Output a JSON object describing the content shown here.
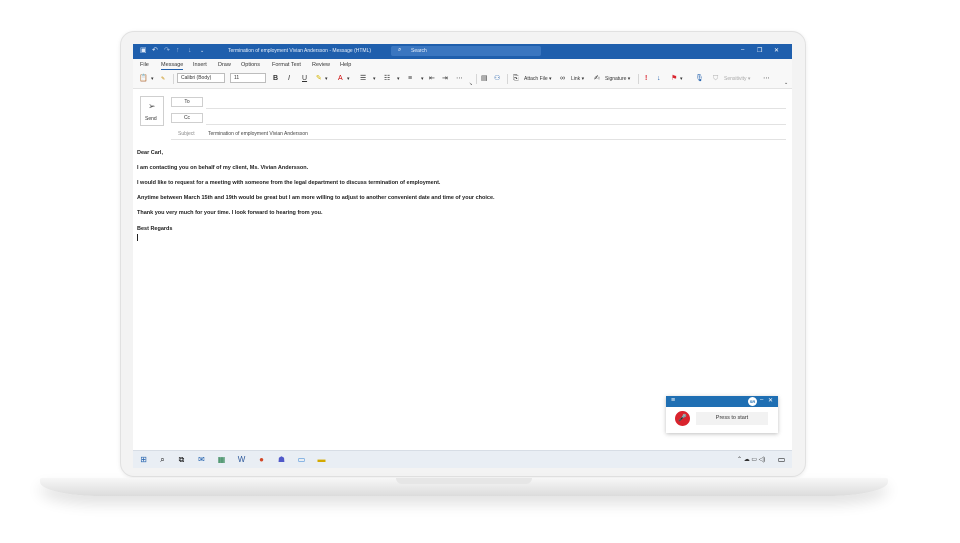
{
  "window": {
    "title": "Termination of employment Vivian Andersson  -  Message (HTML)",
    "search_placeholder": "Search"
  },
  "menu": [
    "File",
    "Message",
    "Insert",
    "Draw",
    "Options",
    "Format Text",
    "Review",
    "Help"
  ],
  "ribbon": {
    "font": "Calibri (Body)",
    "size": "11",
    "attach_file": "Attach File",
    "link": "Link",
    "signature": "Signature",
    "sensitivity": "Sensitivity"
  },
  "compose": {
    "send_label": "Send",
    "to_label": "To",
    "cc_label": "Cc",
    "subject_label": "Subject",
    "subject_value": "Termination of employment Vivian Andersson"
  },
  "body": [
    "Dear Carl,",
    "I am contacting you on behalf of my client, Ms. Vivian Andersson.",
    "I would like to request for a meeting with someone from the legal department to discuss termination of employment.",
    "Anytime between March 15th and 19th would be great but I am more willing to adjust to another convenient date and time of your choice.",
    "Thank you very much for your time. I look forward to hearing from you.",
    "Best Regards"
  ],
  "voice_widget": {
    "avatar_initials": "SR",
    "button_label": "Press to start"
  },
  "colors": {
    "titlebar": "#1f5fad",
    "mic": "#d9232d"
  }
}
